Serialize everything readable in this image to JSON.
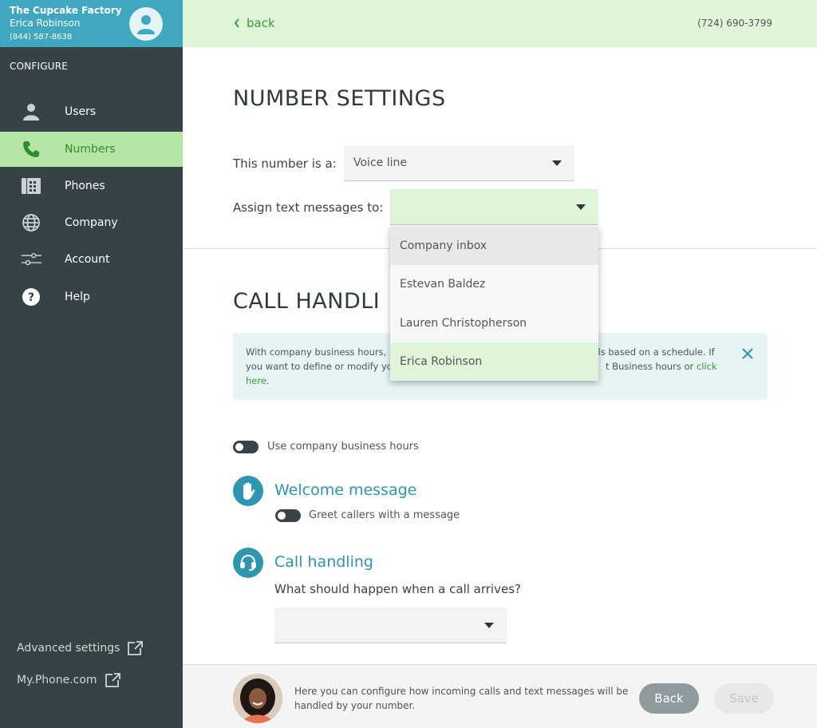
{
  "account": {
    "company": "The Cupcake Factory",
    "user": "Erica Robinson",
    "phone": "(844) 587-8638"
  },
  "sidebar": {
    "section_title": "CONFIGURE",
    "items": [
      {
        "label": "Users",
        "icon": "user-icon"
      },
      {
        "label": "Numbers",
        "icon": "phone-icon",
        "active": true
      },
      {
        "label": "Phones",
        "icon": "desk-phone-icon"
      },
      {
        "label": "Company",
        "icon": "globe-icon"
      },
      {
        "label": "Account",
        "icon": "sliders-icon"
      },
      {
        "label": "Help",
        "icon": "help-icon"
      }
    ],
    "advanced_settings": "Advanced settings",
    "my_phone": "My.Phone.com"
  },
  "topbar": {
    "back_label": "back",
    "number": "(724) 690-3799"
  },
  "number_settings": {
    "title": "NUMBER SETTINGS",
    "type_label": "This number is a:",
    "type_value": "Voice line",
    "assign_label": "Assign text messages to:",
    "assign_value": ""
  },
  "dropdown": {
    "options": [
      "Company inbox",
      "Estevan Baldez",
      "Lauren Christopherson",
      "Erica Robinson"
    ],
    "hovered": "Company inbox",
    "selected": "Erica Robinson"
  },
  "call_handling_section": {
    "title": "CALL HANDLI",
    "info_line1": "With company business hours,",
    "info_line1_right": "g calls based on a schedule. If",
    "info_line2": "you want to define or modify yo",
    "info_line2_right": "t Business hours or",
    "info_link_a": "click",
    "info_link_b": "here",
    "info_period": ".",
    "business_hours_toggle": "Use company business hours",
    "business_hours_on": false
  },
  "welcome": {
    "title": "Welcome message",
    "toggle_label": "Greet callers with a message",
    "toggle_on": false
  },
  "call_handling": {
    "title": "Call handling",
    "question": "What should happen when a call arrives?",
    "select_value": ""
  },
  "footer": {
    "help_text_line1": "Here you can configure how incoming calls and text messages will be",
    "help_text_line2": "handled by your number.",
    "back_button": "Back",
    "save_button": "Save"
  },
  "colors": {
    "sidebar_bg": "#354246",
    "header_teal": "#3fa7bf",
    "accent_green": "#3a9a35",
    "light_green": "#dff5d9",
    "section_blue": "#2f96b0"
  }
}
